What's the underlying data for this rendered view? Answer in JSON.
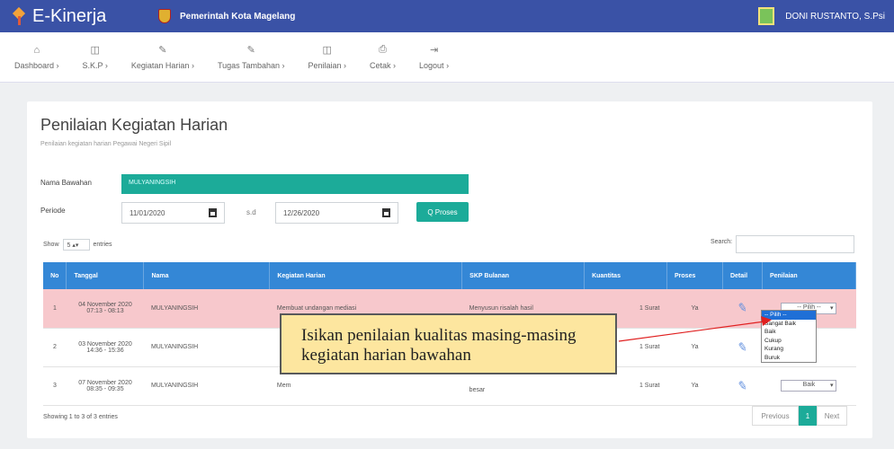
{
  "topbar": {
    "app_name": "E-Kinerja",
    "government": "Pemerintah Kota Magelang",
    "user_name": "DONI RUSTANTO, S.Psi",
    "colors": {
      "topbar": "#3a52a6",
      "accent": "#1cab99",
      "table_header": "#3487d6",
      "highlight_row": "#f7c8cc"
    }
  },
  "nav": [
    {
      "label": "Dashboard",
      "icon": "home-icon",
      "glyph": "⌂"
    },
    {
      "label": "S.K.P",
      "icon": "document-icon",
      "glyph": "◫"
    },
    {
      "label": "Kegiatan Harian",
      "icon": "edit-icon",
      "glyph": "✎"
    },
    {
      "label": "Tugas Tambahan",
      "icon": "edit-icon",
      "glyph": "✎"
    },
    {
      "label": "Penilaian",
      "icon": "document-icon",
      "glyph": "◫"
    },
    {
      "label": "Cetak",
      "icon": "print-icon",
      "glyph": "⎙"
    },
    {
      "label": "Logout",
      "icon": "logout-icon",
      "glyph": "⇥"
    }
  ],
  "page": {
    "title": "Penilaian Kegiatan Harian",
    "subtitle": "Penilaian kegiatan harian Pegawai Negeri Sipil"
  },
  "filter": {
    "bawahan_label": "Nama Bawahan",
    "bawahan_value": "MULYANINGSIH",
    "periode_label": "Periode",
    "date_from": "11/01/2020",
    "sd": "s.d",
    "date_to": "12/26/2020",
    "proses_button": "Q Proses"
  },
  "table_controls": {
    "show_label": "Show",
    "show_value": "5",
    "entries_label": "entries",
    "search_label": "Search:"
  },
  "table": {
    "headers": [
      "No",
      "Tanggal",
      "Nama",
      "Kegiatan Harian",
      "SKP Bulanan",
      "Kuantitas",
      "Proses",
      "Detail",
      "Penilaian"
    ],
    "rows": [
      {
        "no": "1",
        "tanggal": "04 November 2020",
        "jam": "07:13 - 08:13",
        "nama": "MULYANINGSIH",
        "kegiatan": "Membuat undangan mediasi",
        "skp": "Menyusun risalah hasil",
        "skp2": "",
        "kuantitas": "1 Surat",
        "proses": "Ya",
        "penilaian": "-- Pilih --"
      },
      {
        "no": "2",
        "tanggal": "03 November 2020",
        "jam": "14:36 - 15:36",
        "nama": "MULYANINGSIH",
        "kegiatan": "",
        "skp": "",
        "skp2": "",
        "kuantitas": "1 Surat",
        "proses": "Ya",
        "penilaian": ""
      },
      {
        "no": "3",
        "tanggal": "07 November 2020",
        "jam": "08:35 - 09:35",
        "nama": "MULYANINGSIH",
        "kegiatan": "Mem",
        "skp": "",
        "skp2": "besar",
        "kuantitas": "1 Surat",
        "proses": "Ya",
        "penilaian": "Baik"
      }
    ]
  },
  "rating_options": [
    "-- Pilih --",
    "Sangat Baik",
    "Baik",
    "Cukup",
    "Kurang",
    "Buruk"
  ],
  "footer": {
    "showing": "Showing 1 to 3 of 3 entries",
    "previous": "Previous",
    "page": "1",
    "next": "Next"
  },
  "callout": {
    "text": "Isikan penilaian kualitas masing-masing kegiatan harian bawahan",
    "color": "#fde69f"
  }
}
